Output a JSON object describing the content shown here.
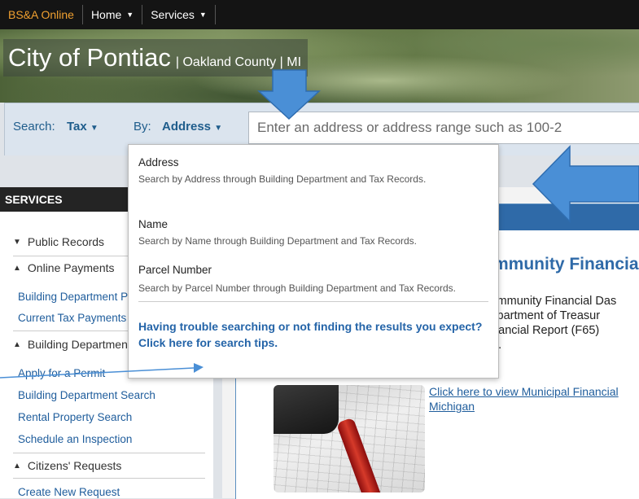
{
  "nav": {
    "brand": "BS&A Online",
    "home_label": "Home",
    "services_label": "Services"
  },
  "banner": {
    "city_name": "City of Pontiac",
    "county_text": "| Oakland County | MI"
  },
  "search": {
    "search_label": "Search:",
    "search_type": "Tax",
    "by_label": "By:",
    "by_value": "Address",
    "placeholder": "Enter an address or address range such as 100-2"
  },
  "dropdown": {
    "options": [
      {
        "title": "Address",
        "description": "Search by Address through Building Department and Tax Records."
      },
      {
        "title": "Name",
        "description": "Search by Name through Building Department and Tax Records."
      },
      {
        "title": "Parcel Number",
        "description": "Search by Parcel Number through Building Department and Tax Records."
      }
    ],
    "help_text": "Having trouble searching or not finding the results you expect? Click here for search tips."
  },
  "sidebar": {
    "header": "SERVICES",
    "groups": [
      {
        "label": "Public Records",
        "expanded": false
      },
      {
        "label": "Online Payments",
        "expanded": true
      },
      {
        "label": "Building Department",
        "expanded": true
      },
      {
        "label": "Citizens' Requests",
        "expanded": true
      }
    ],
    "links": {
      "payments": [
        "Building Department Payments",
        "Current Tax Payments"
      ],
      "building": [
        "Apply for a Permit",
        "Building Department Search",
        "Rental Property Search",
        "Schedule an Inspection"
      ],
      "requests": [
        "Create New Request"
      ]
    }
  },
  "main": {
    "title": "Community Financial",
    "description_lines": [
      "Community Financial Das",
      "Department of Treasur",
      "Financial Report (F65)",
      "ent."
    ],
    "link_text": "Click here to view Municipal Financial Michigan"
  },
  "colors": {
    "brand_orange": "#f0a030",
    "link_blue": "#1f5d9c",
    "panel_blue": "#2f6aa8",
    "arrow_blue": "#4a8fd6"
  },
  "icons": {
    "caret": "caret-down-icon",
    "collapsed_group": "triangle-down-icon",
    "expanded_group": "triangle-up-icon"
  }
}
